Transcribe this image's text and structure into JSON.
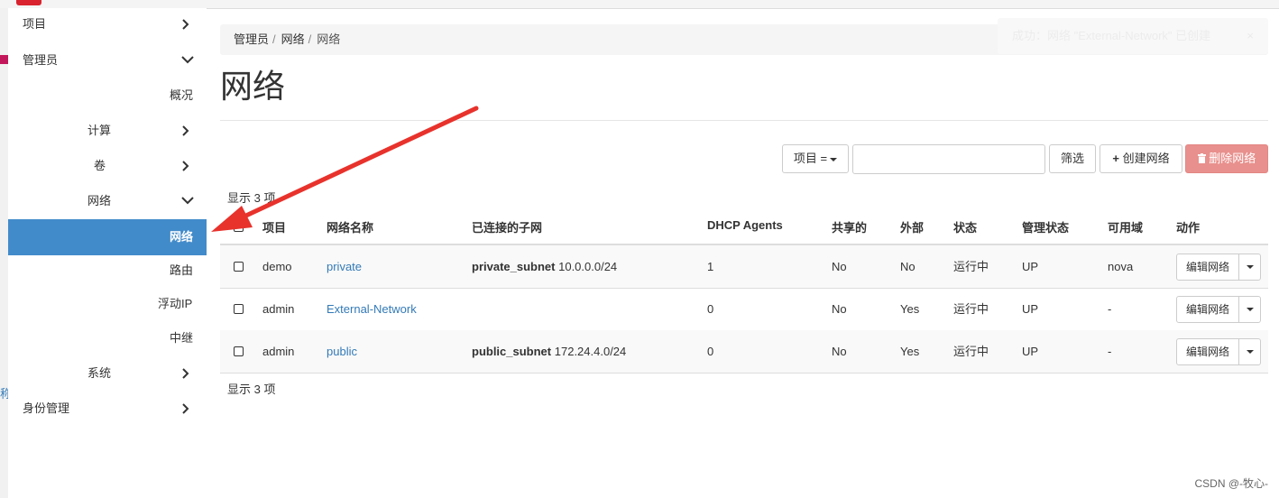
{
  "sidebar": {
    "project": "项目",
    "admin": "管理员",
    "overview": "概况",
    "compute": "计算",
    "volumes": "卷",
    "network": "网络",
    "networks": "网络",
    "routers": "路由",
    "floating_ips": "浮动IP",
    "trunks": "中继",
    "system": "系统",
    "identity": "身份管理"
  },
  "breadcrumb": [
    "管理员",
    "网络",
    "网络"
  ],
  "toast": {
    "text": "成功：网络 \"External-Network\" 已创建",
    "close": "×"
  },
  "page_title": "网络",
  "toolbar": {
    "filter_select": "项目 =",
    "filter_button": "筛选",
    "create_button": "创建网络",
    "delete_button": "删除网络"
  },
  "count_text": "显示 3 项",
  "table": {
    "headers": [
      "项目",
      "网络名称",
      "已连接的子网",
      "DHCP Agents",
      "共享的",
      "外部",
      "状态",
      "管理状态",
      "可用域",
      "动作"
    ],
    "rows": [
      {
        "project": "demo",
        "name": "private",
        "subnet_name": "private_subnet",
        "subnet_cidr": "10.0.0.0/24",
        "dhcp": "1",
        "shared": "No",
        "external": "No",
        "status": "运行中",
        "admin_state": "UP",
        "zone": "nova",
        "action": "编辑网络"
      },
      {
        "project": "admin",
        "name": "External-Network",
        "subnet_name": "",
        "subnet_cidr": "",
        "dhcp": "0",
        "shared": "No",
        "external": "Yes",
        "status": "运行中",
        "admin_state": "UP",
        "zone": "-",
        "action": "编辑网络"
      },
      {
        "project": "admin",
        "name": "public",
        "subnet_name": "public_subnet",
        "subnet_cidr": "172.24.4.0/24",
        "dhcp": "0",
        "shared": "No",
        "external": "Yes",
        "status": "运行中",
        "admin_state": "UP",
        "zone": "-",
        "action": "编辑网络"
      }
    ]
  },
  "watermark": "CSDN @-牧心-",
  "colors": {
    "active": "#428bca",
    "link": "#337ab7",
    "danger": "#e8908d",
    "arrow": "#e8322c"
  }
}
